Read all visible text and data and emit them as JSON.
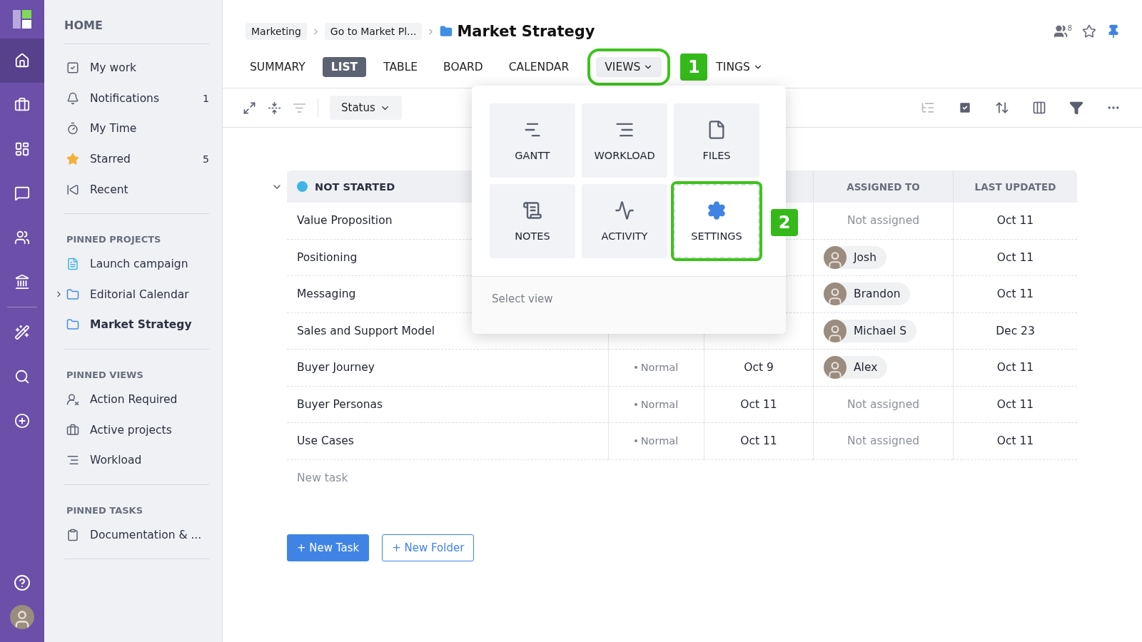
{
  "rail": {
    "items": [
      {
        "kind": "home",
        "selected": true
      },
      {
        "kind": "briefcase",
        "selected": false
      },
      {
        "kind": "panels",
        "selected": false
      },
      {
        "kind": "chat",
        "selected": false
      },
      {
        "kind": "users",
        "selected": false
      },
      {
        "kind": "bank",
        "selected": false
      },
      {
        "kind": "wand",
        "selected": false
      },
      {
        "kind": "search",
        "selected": false
      },
      {
        "kind": "plus",
        "selected": false
      }
    ]
  },
  "sidebar": {
    "title": "HOME",
    "items": [
      {
        "kind": "check",
        "label": "My work"
      },
      {
        "kind": "bell",
        "label": "Notifications",
        "count": "1"
      },
      {
        "kind": "timer",
        "label": "My Time"
      },
      {
        "kind": "star",
        "label": "Starred",
        "count": "5"
      },
      {
        "kind": "recent",
        "label": "Recent"
      }
    ],
    "sections": [
      {
        "title": "PINNED PROJECTS",
        "items": [
          {
            "kind": "doc",
            "label": "Launch campaign",
            "selected": false,
            "expandable": false
          },
          {
            "kind": "folder",
            "label": "Editorial Calendar",
            "selected": false,
            "expandable": true
          },
          {
            "kind": "folder",
            "label": "Market Strategy",
            "selected": true,
            "expandable": false
          }
        ]
      },
      {
        "title": "PINNED VIEWS",
        "items": [
          {
            "kind": "user-alert",
            "label": "Action Required",
            "selected": false,
            "expandable": false
          },
          {
            "kind": "briefcase",
            "label": "Active projects",
            "selected": false,
            "expandable": false
          },
          {
            "kind": "workload",
            "label": "Workload",
            "selected": false,
            "expandable": false
          }
        ]
      },
      {
        "title": "PINNED TASKS",
        "items": [
          {
            "kind": "clipboard",
            "label": "Documentation & ...",
            "selected": false,
            "expandable": false
          }
        ]
      }
    ]
  },
  "breadcrumbs": [
    "Marketing",
    "Go to Market Pl..."
  ],
  "page_title": "Market Strategy",
  "header": {
    "members_count": "8"
  },
  "tabs": [
    {
      "label": "SUMMARY",
      "selected": false,
      "dropdown": false,
      "highlighted": false
    },
    {
      "label": "LIST",
      "selected": true,
      "dropdown": false,
      "highlighted": false
    },
    {
      "label": "TABLE",
      "selected": false,
      "dropdown": false,
      "highlighted": false
    },
    {
      "label": "BOARD",
      "selected": false,
      "dropdown": false,
      "highlighted": false
    },
    {
      "label": "CALENDAR",
      "selected": false,
      "dropdown": false,
      "highlighted": false
    },
    {
      "label": "VIEWS",
      "selected": false,
      "dropdown": true,
      "highlighted": true
    },
    {
      "label": "TINGS",
      "selected": false,
      "dropdown": true,
      "highlighted": false
    }
  ],
  "toolbar": {
    "group_by": "Status"
  },
  "table": {
    "group": {
      "label": "NOT STARTED",
      "color": "#3fb5e6",
      "expanded": true
    },
    "columns": [
      "",
      "",
      "",
      "ASSIGNED TO",
      "LAST UPDATED"
    ],
    "rows": [
      {
        "task": "Value Proposition",
        "assignee": {
          "kind": "none",
          "text": "Not assigned"
        },
        "updated": "Oct 11"
      },
      {
        "task": "Positioning",
        "assignee": {
          "kind": "person",
          "text": "Josh"
        },
        "updated": "Oct 11"
      },
      {
        "task": "Messaging",
        "assignee": {
          "kind": "person",
          "text": "Brandon"
        },
        "updated": "Oct 11"
      },
      {
        "task": "Sales and Support Model",
        "assignee": {
          "kind": "person",
          "text": "Michael S"
        },
        "updated": "Dec 23"
      },
      {
        "task": "Buyer Journey",
        "importance": "Normal",
        "due": "Oct 9",
        "assignee": {
          "kind": "person",
          "text": "Alex"
        },
        "updated": "Oct 11"
      },
      {
        "task": "Buyer Personas",
        "importance": "Normal",
        "due": "Oct 11",
        "assignee": {
          "kind": "none",
          "text": "Not assigned"
        },
        "updated": "Oct 11"
      },
      {
        "task": "Use Cases",
        "importance": "Normal",
        "due": "Oct 11",
        "assignee": {
          "kind": "none",
          "text": "Not assigned"
        },
        "updated": "Oct 11"
      }
    ],
    "new_task_placeholder": "New task"
  },
  "buttons": [
    {
      "label": "+ New Task",
      "kind": "primary"
    },
    {
      "label": "+ New Folder",
      "kind": "secondary"
    }
  ],
  "views_menu": {
    "tiles": [
      {
        "kind": "gantt",
        "label": "GANTT",
        "highlighted": false
      },
      {
        "kind": "workload",
        "label": "WORKLOAD",
        "highlighted": false
      },
      {
        "kind": "file",
        "label": "FILES",
        "highlighted": false
      },
      {
        "kind": "notes",
        "label": "NOTES",
        "highlighted": false
      },
      {
        "kind": "activity",
        "label": "ACTIVITY",
        "highlighted": false
      },
      {
        "kind": "settings",
        "label": "SETTINGS",
        "highlighted": true
      }
    ],
    "footer": "Select view"
  },
  "annotations": [
    {
      "label": "1"
    },
    {
      "label": "2"
    }
  ]
}
